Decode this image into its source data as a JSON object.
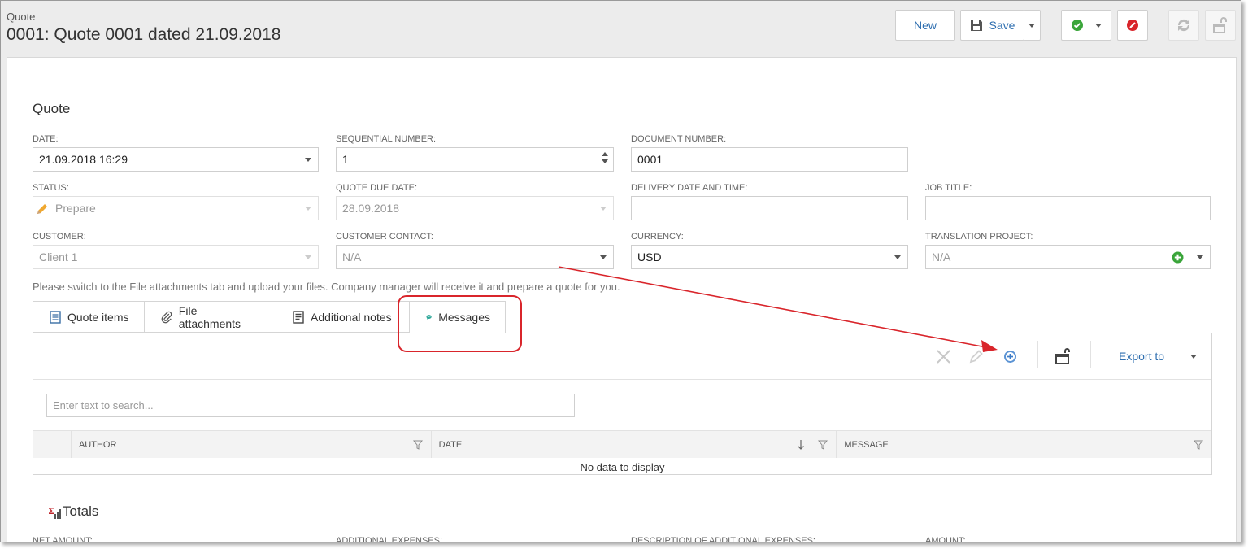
{
  "header": {
    "breadcrumb": "Quote",
    "title": "0001: Quote 0001 dated 21.09.2018"
  },
  "toolbar": {
    "new_label": "New",
    "save_label": "Save"
  },
  "form": {
    "section_title": "Quote",
    "date_label": "DATE:",
    "date_value": "21.09.2018 16:29",
    "seq_label": "SEQUENTIAL NUMBER:",
    "seq_value": "1",
    "docnum_label": "DOCUMENT NUMBER:",
    "docnum_value": "0001",
    "status_label": "STATUS:",
    "status_value": "Prepare",
    "due_label": "QUOTE DUE DATE:",
    "due_value": "28.09.2018",
    "delivery_label": "DELIVERY DATE AND TIME:",
    "delivery_value": "",
    "job_label": "JOB TITLE:",
    "job_value": "",
    "customer_label": "CUSTOMER:",
    "customer_value": "Client 1",
    "contact_label": "CUSTOMER CONTACT:",
    "contact_value": "N/A",
    "currency_label": "CURRENCY:",
    "currency_value": "USD",
    "project_label": "TRANSLATION PROJECT:",
    "project_value": "N/A"
  },
  "hint": "Please switch to the File attachments tab and upload your files. Company manager will receive it and prepare a quote for you.",
  "tabs": [
    {
      "label": "Quote items"
    },
    {
      "label": "File attachments"
    },
    {
      "label": "Additional notes"
    },
    {
      "label": "Messages"
    }
  ],
  "grid": {
    "export_label": "Export to",
    "search_placeholder": "Enter text to search...",
    "columns": [
      {
        "label": "AUTHOR"
      },
      {
        "label": "DATE"
      },
      {
        "label": "MESSAGE"
      }
    ],
    "empty_text": "No data to display"
  },
  "totals": {
    "title": "Totals",
    "net_amount_label": "NET AMOUNT:",
    "additional_expenses_label": "ADDITIONAL EXPENSES:",
    "description_label": "DESCRIPTION OF ADDITIONAL EXPENSES:",
    "amount_label": "AMOUNT:"
  },
  "colors": {
    "accent": "#2f6fb0",
    "annotation": "#d9252b",
    "ok_green": "#3aa53a",
    "cancel_red": "#d9252b"
  },
  "icons": [
    "save-icon",
    "check-icon",
    "cancel-icon",
    "refresh-icon",
    "unlock-icon",
    "pencil-icon",
    "document-icon",
    "paperclip-icon",
    "notes-icon",
    "chat-icon",
    "close-icon",
    "edit-icon",
    "add-icon",
    "layout-icon",
    "filter-icon",
    "sort-down-icon",
    "sigma-icon"
  ]
}
